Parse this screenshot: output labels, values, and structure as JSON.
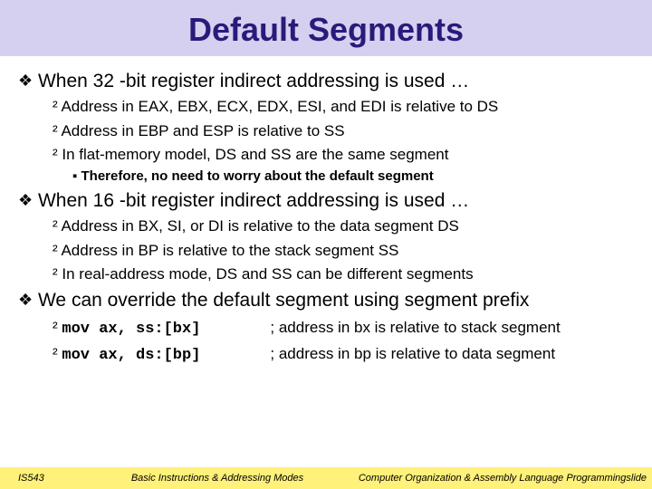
{
  "title": "Default Segments",
  "l1_0": "When 32 -bit register indirect addressing is used …",
  "l2_0_0": "Address in EAX, EBX, ECX, EDX, ESI, and EDI is relative to DS",
  "l2_0_1": "Address in EBP and ESP is relative to SS",
  "l2_0_2": "In flat-memory model, DS and SS are the same segment",
  "l3_0_2_0": "Therefore, no need to worry about the default segment",
  "l1_1": "When 16 -bit register indirect addressing is used …",
  "l2_1_0": "Address in BX, SI, or DI is relative to the data segment DS",
  "l2_1_1": "Address in BP is relative to the stack segment SS",
  "l2_1_2": "In real-address mode, DS and SS can be different segments",
  "l1_2": "We can override the default segment using segment prefix",
  "code1": "mov ax, ss:[bx]",
  "comment1": "; address in bx is relative to stack segment",
  "code2": "mov ax, ds:[bp]",
  "comment2": "; address in bp is relative to data segment",
  "footer_left": "IS543",
  "footer_center": "Basic Instructions & Addressing Modes",
  "footer_right": "Computer Organization & Assembly Language Programmingslide"
}
